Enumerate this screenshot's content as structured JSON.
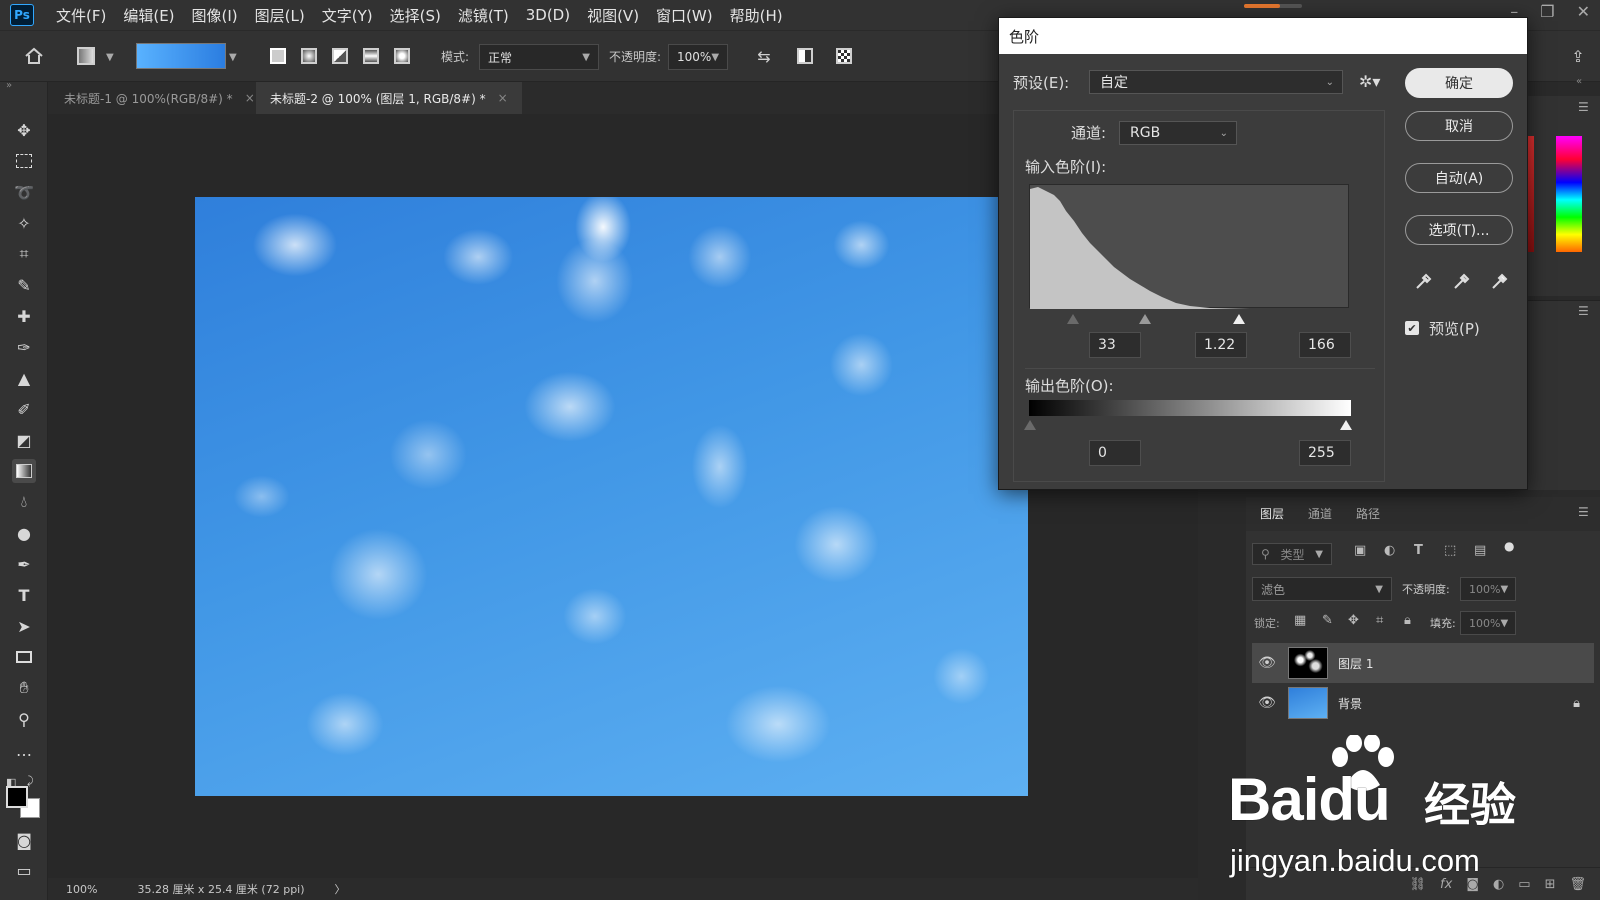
{
  "app": {
    "logo": "Ps",
    "menu": [
      "文件(F)",
      "编辑(E)",
      "图像(I)",
      "图层(L)",
      "文字(Y)",
      "选择(S)",
      "滤镜(T)",
      "3D(D)",
      "视图(V)",
      "窗口(W)",
      "帮助(H)"
    ]
  },
  "options": {
    "mode_label": "模式:",
    "mode_value": "正常",
    "opacity_label": "不透明度:",
    "opacity_value": "100%"
  },
  "tabs": [
    {
      "label": "未标题-1 @ 100%(RGB/8#) *",
      "close": "×"
    },
    {
      "label": "未标题-2 @ 100% (图层 1, RGB/8#) *",
      "close": "×"
    }
  ],
  "status": {
    "zoom": "100%",
    "doc_info": "35.28 厘米 x 25.4 厘米 (72 ppi)",
    "arrow": "〉"
  },
  "levels": {
    "title": "色阶",
    "preset_label": "预设(E):",
    "preset_value": "自定",
    "channel_label": "通道:",
    "channel_value": "RGB",
    "input_label": "输入色阶(I):",
    "input_black": "33",
    "input_gamma": "1.22",
    "input_white": "166",
    "output_label": "输出色阶(O):",
    "output_black": "0",
    "output_white": "255",
    "btn_ok": "确定",
    "btn_cancel": "取消",
    "btn_auto": "自动(A)",
    "btn_options": "选项(T)...",
    "preview_label": "预览(P)",
    "preview_checked": true
  },
  "layers_panel": {
    "tabs": [
      "图层",
      "通道",
      "路径"
    ],
    "filter_placeholder": "类型",
    "blend_mode": "滤色",
    "opacity_label": "不透明度:",
    "opacity_value": "100%",
    "lock_label": "锁定:",
    "fill_label": "填充:",
    "fill_value": "100%",
    "layers": [
      {
        "name": "图层 1",
        "selected": true
      },
      {
        "name": "背景",
        "locked": true
      }
    ]
  },
  "watermark": {
    "brand": "Baidu",
    "suffix": "经验",
    "url": "jingyan.baidu.com"
  },
  "colors": {
    "accent": "#31a8ff",
    "canvas_sky": "#3f93e4",
    "dialog_bg": "#3c3c3c"
  }
}
